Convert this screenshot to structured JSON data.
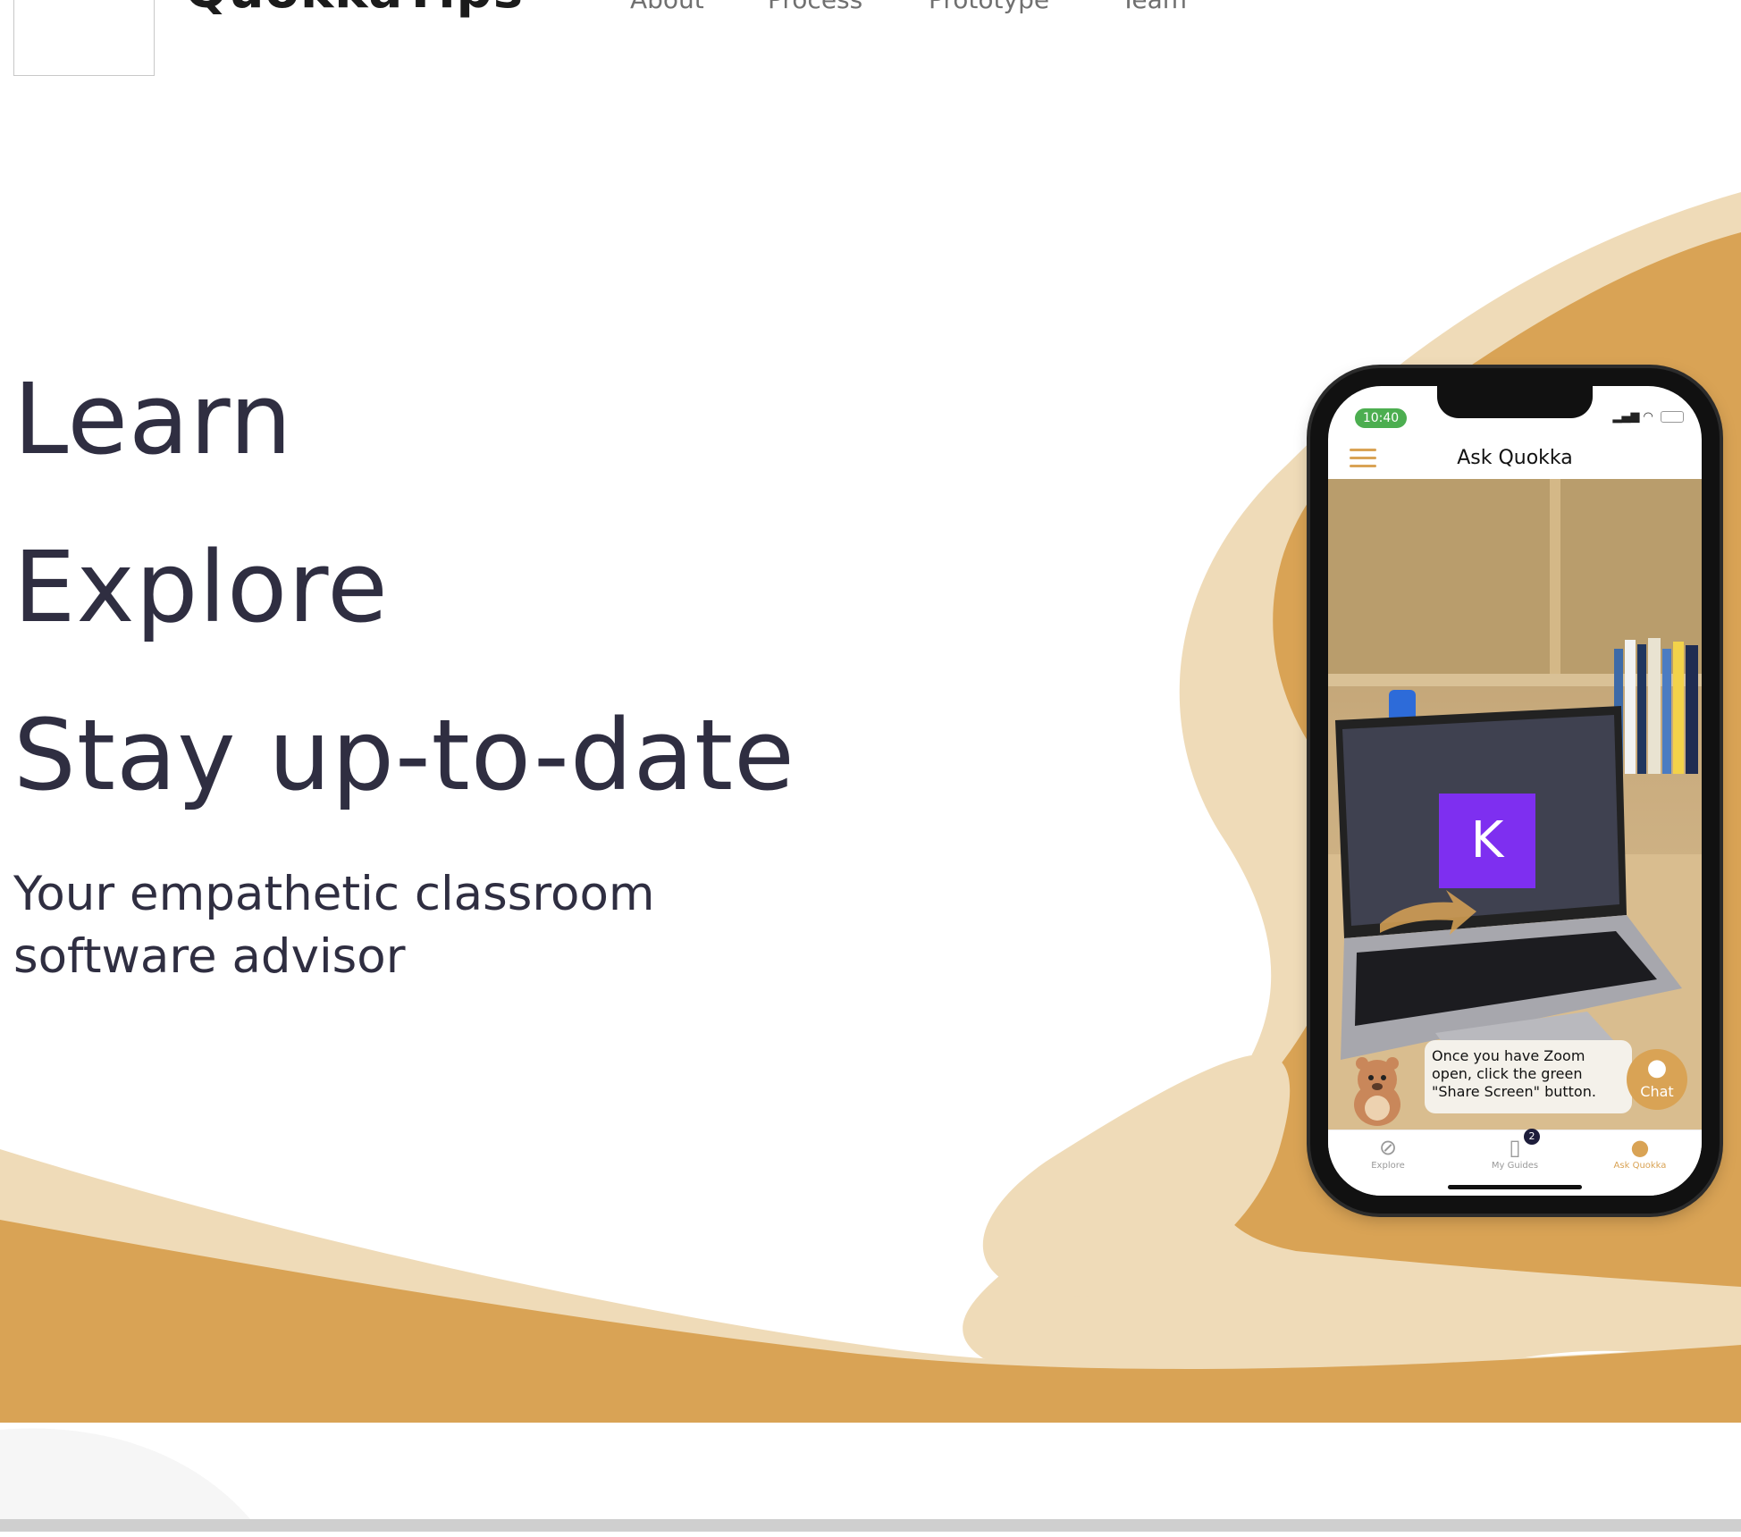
{
  "header": {
    "brand": "QuokkaTips",
    "nav": [
      "About",
      "Process",
      "Prototype",
      "Team"
    ]
  },
  "hero": {
    "lines": [
      "Learn",
      "Explore",
      "Stay up-to-date"
    ],
    "tagline_line1": "Your empathetic classroom",
    "tagline_line2": "software advisor"
  },
  "phone": {
    "time": "10:40",
    "app_title": "Ask Quokka",
    "tile_letter": "K",
    "bubble_text": "Once you have Zoom open, click the green \"Share Screen\" button.",
    "chat_label": "Chat",
    "badge_count": "2",
    "tabs": [
      {
        "label": "Explore",
        "icon": "compass-icon"
      },
      {
        "label": "My Guides",
        "icon": "book-icon"
      },
      {
        "label": "Ask Quokka",
        "icon": "chat-icon"
      }
    ]
  },
  "colors": {
    "gold": "#d9a355",
    "sand": "#efdbb8",
    "text": "#2f2e41"
  }
}
